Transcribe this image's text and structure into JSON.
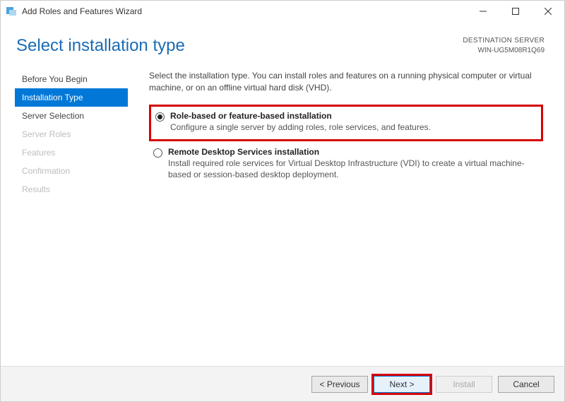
{
  "window": {
    "title": "Add Roles and Features Wizard"
  },
  "header": {
    "title": "Select installation type",
    "destination_label": "DESTINATION SERVER",
    "destination_value": "WIN-UG5M08R1Q69"
  },
  "sidebar": {
    "items": [
      {
        "label": "Before You Begin",
        "state": "enabled"
      },
      {
        "label": "Installation Type",
        "state": "active"
      },
      {
        "label": "Server Selection",
        "state": "enabled"
      },
      {
        "label": "Server Roles",
        "state": "disabled"
      },
      {
        "label": "Features",
        "state": "disabled"
      },
      {
        "label": "Confirmation",
        "state": "disabled"
      },
      {
        "label": "Results",
        "state": "disabled"
      }
    ]
  },
  "main": {
    "intro": "Select the installation type. You can install roles and features on a running physical computer or virtual machine, or on an offline virtual hard disk (VHD).",
    "options": [
      {
        "title": "Role-based or feature-based installation",
        "desc": "Configure a single server by adding roles, role services, and features.",
        "selected": true,
        "highlighted": true
      },
      {
        "title": "Remote Desktop Services installation",
        "desc": "Install required role services for Virtual Desktop Infrastructure (VDI) to create a virtual machine-based or session-based desktop deployment.",
        "selected": false,
        "highlighted": false
      }
    ]
  },
  "footer": {
    "previous": "< Previous",
    "next": "Next >",
    "install": "Install",
    "cancel": "Cancel"
  }
}
